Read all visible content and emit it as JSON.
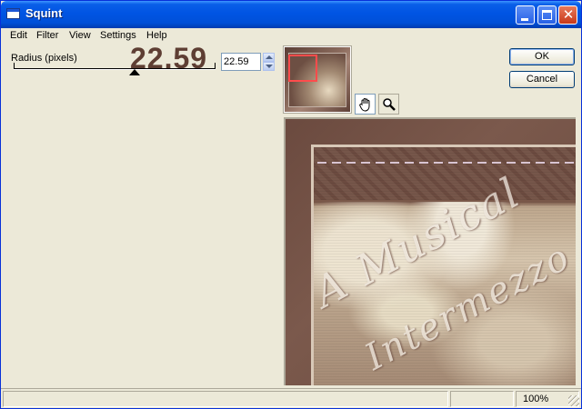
{
  "window": {
    "title": "Squint"
  },
  "menu": {
    "items": [
      "Edit",
      "Filter",
      "View",
      "Settings",
      "Help"
    ]
  },
  "radius": {
    "label": "Radius (pixels)",
    "display_value": "22.59",
    "input_value": "22.59"
  },
  "buttons": {
    "ok": "OK",
    "cancel": "Cancel"
  },
  "tools": {
    "hand": "hand-icon",
    "zoom": "magnifier-icon"
  },
  "preview": {
    "text_line_1": "A Musical",
    "text_line_2": "Intermezzo"
  },
  "status": {
    "zoom": "100%"
  },
  "colors": {
    "titlebar": "#0054e3",
    "big_value": "#5e3e33",
    "roi": "#ff4c4c"
  }
}
